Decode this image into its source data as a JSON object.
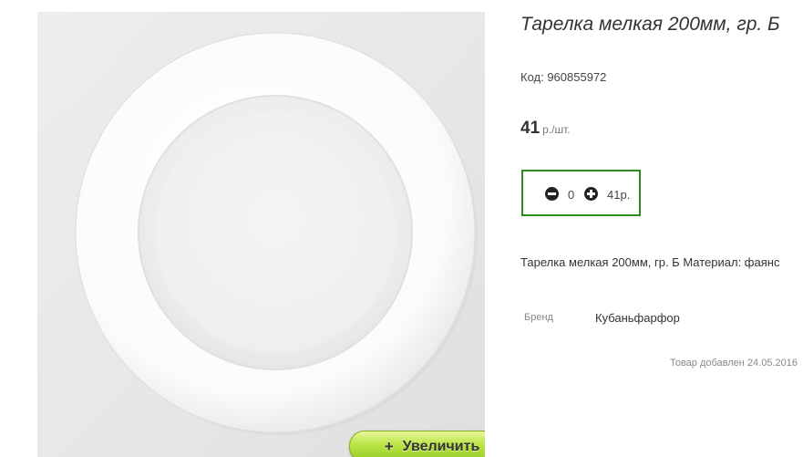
{
  "product": {
    "title": "Тарелка мелкая 200мм, гр. Б",
    "code": "Код: 960855972",
    "price_value": "41",
    "price_unit": "р./шт.",
    "description": "Тарелка мелкая 200мм, гр. Б Материал: фаянс",
    "brand_label": "Бренд",
    "brand_value": "Кубаньфарфор",
    "added": "Товар добавлен 24.05.2016"
  },
  "quantity": {
    "value": "0",
    "sum": "41р."
  },
  "gallery": {
    "zoom_plus": "+",
    "zoom_label": "Увеличить"
  },
  "colors": {
    "border_green": "#2e8b1f",
    "button_green": "#96cc25"
  },
  "icons": {
    "minus": "minus-circle-icon",
    "plus": "plus-circle-icon"
  }
}
